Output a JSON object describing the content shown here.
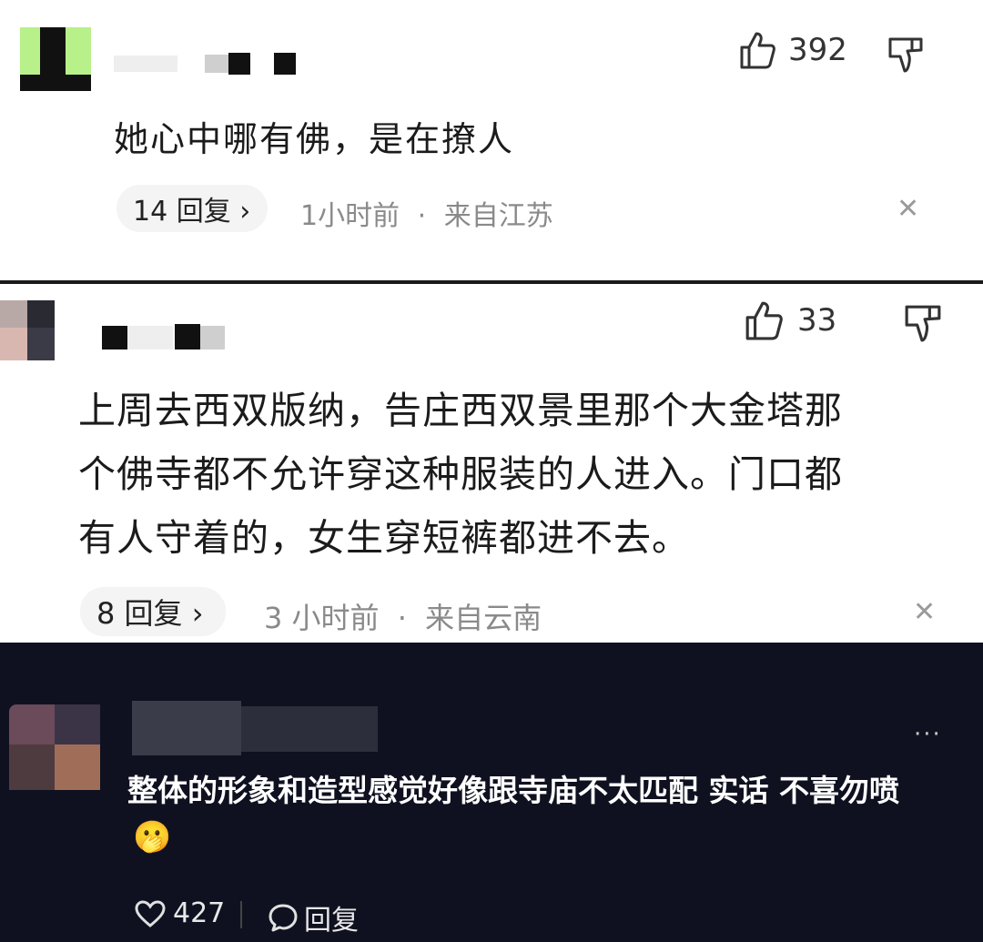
{
  "comments": [
    {
      "text": "她心中哪有佛，是在撩人",
      "likes": "392",
      "reply_label": "14 回复 ›",
      "time": "1小时前",
      "separator": "·",
      "location": "来自江苏",
      "close_glyph": "✕"
    },
    {
      "text_lines": [
        "上周去西双版纳，告庄西双景里那个大金塔那",
        "个佛寺都不允许穿这种服装的人进入。门口都",
        "有人守着的，女生穿短裤都进不去。"
      ],
      "likes": "33",
      "reply_label": "8 回复 ›",
      "time": "3 小时前",
      "separator": "·",
      "location": "来自云南",
      "close_glyph": "✕"
    },
    {
      "text_lines": [
        "整体的形象和造型感觉好像跟寺庙不太匹配 实话 不喜勿喷"
      ],
      "emoji": "🫢",
      "more_glyph": "···",
      "likes": "427",
      "reply_label": "回复"
    }
  ],
  "colors": {
    "dark_panel_bg": "#0f1120",
    "avatar1_green": "#b8f08a",
    "text_dark": "#1b1b1b",
    "meta_gray": "#8a8a8a"
  },
  "icons": [
    "thumbs-up-icon",
    "thumbs-down-icon",
    "close-icon",
    "heart-icon",
    "comment-bubble-icon",
    "more-icon"
  ]
}
